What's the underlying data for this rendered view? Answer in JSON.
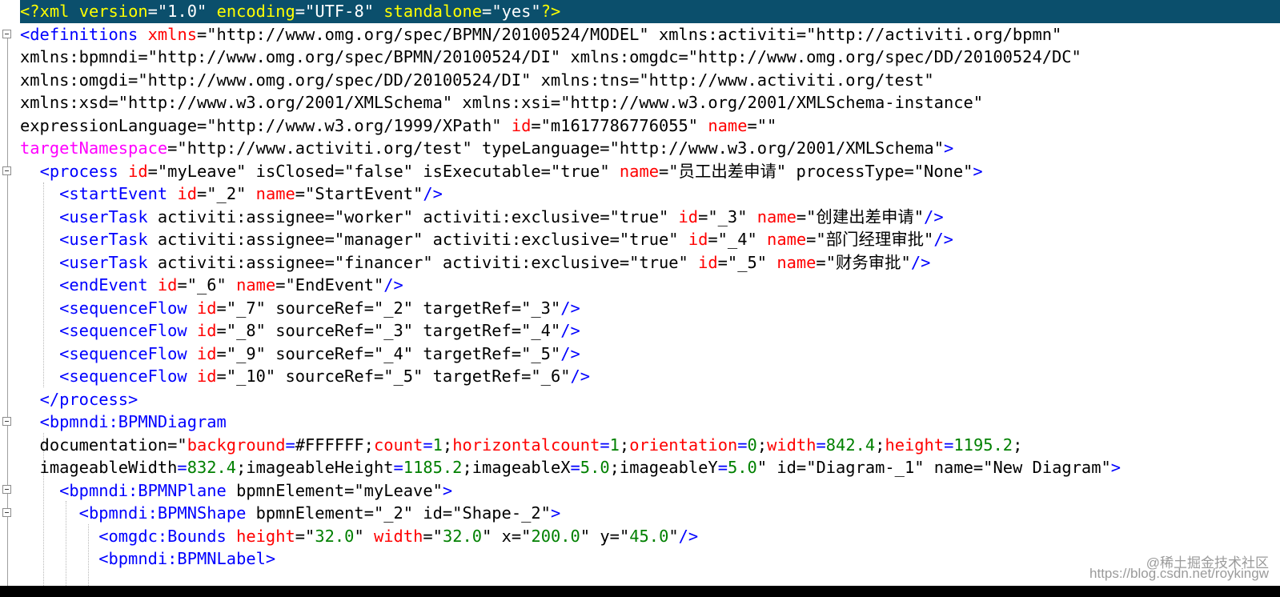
{
  "editor": {
    "lines": [
      {
        "kind": "decl",
        "segments": [
          {
            "c": "pi",
            "t": "<?"
          },
          {
            "c": "pi",
            "t": "xml"
          },
          {
            "c": "pv",
            "t": " "
          },
          {
            "c": "pi",
            "t": "version"
          },
          {
            "c": "pv",
            "t": "=\"1.0\" "
          },
          {
            "c": "pi",
            "t": "encoding"
          },
          {
            "c": "pv",
            "t": "=\"UTF-8\" "
          },
          {
            "c": "pi",
            "t": "standalone"
          },
          {
            "c": "pv",
            "t": "=\"yes\""
          },
          {
            "c": "pi",
            "t": "?>"
          }
        ]
      },
      {
        "segments": [
          {
            "c": "tg",
            "t": "<definitions"
          },
          {
            "c": "t",
            "t": " "
          },
          {
            "c": "at",
            "t": "xmlns"
          },
          {
            "c": "t",
            "t": "=\"http://www.omg.org/spec/BPMN/20100524/MODEL\" xmlns:activiti=\"http://activiti.org/bpmn\""
          }
        ]
      },
      {
        "segments": [
          {
            "c": "t",
            "t": "xmlns:bpmndi=\"http://www.omg.org/spec/BPMN/20100524/DI\" xmlns:omgdc=\"http://www.omg.org/spec/DD/20100524/DC\""
          }
        ]
      },
      {
        "segments": [
          {
            "c": "t",
            "t": "xmlns:omgdi=\"http://www.omg.org/spec/DD/20100524/DI\" xmlns:tns=\"http://www.activiti.org/test\""
          }
        ]
      },
      {
        "segments": [
          {
            "c": "t",
            "t": "xmlns:xsd=\"http://www.w3.org/2001/XMLSchema\" xmlns:xsi=\"http://www.w3.org/2001/XMLSchema-instance\""
          }
        ]
      },
      {
        "segments": [
          {
            "c": "t",
            "t": "expressionLanguage=\"http://www.w3.org/1999/XPath\" "
          },
          {
            "c": "at",
            "t": "id"
          },
          {
            "c": "t",
            "t": "=\"m1617786776055\" "
          },
          {
            "c": "at",
            "t": "name"
          },
          {
            "c": "t",
            "t": "=\"\""
          }
        ]
      },
      {
        "segments": [
          {
            "c": "kw",
            "t": "targetNamespace"
          },
          {
            "c": "t",
            "t": "=\"http://www.activiti.org/test\" typeLanguage=\"http://www.w3.org/2001/XMLSchema\""
          },
          {
            "c": "tg",
            "t": ">"
          }
        ]
      },
      {
        "segments": [
          {
            "c": "t",
            "t": "  "
          },
          {
            "c": "tg",
            "t": "<process"
          },
          {
            "c": "t",
            "t": " "
          },
          {
            "c": "at",
            "t": "id"
          },
          {
            "c": "t",
            "t": "=\"myLeave\" isClosed=\"false\" isExecutable=\"true\" "
          },
          {
            "c": "at",
            "t": "name"
          },
          {
            "c": "t",
            "t": "=\"员工出差申请\" processType=\"None\""
          },
          {
            "c": "tg",
            "t": ">"
          }
        ]
      },
      {
        "segments": [
          {
            "c": "t",
            "t": "    "
          },
          {
            "c": "tg",
            "t": "<startEvent"
          },
          {
            "c": "t",
            "t": " "
          },
          {
            "c": "at",
            "t": "id"
          },
          {
            "c": "t",
            "t": "=\"_2\" "
          },
          {
            "c": "at",
            "t": "name"
          },
          {
            "c": "t",
            "t": "=\"StartEvent\""
          },
          {
            "c": "tg",
            "t": "/>"
          }
        ]
      },
      {
        "segments": [
          {
            "c": "t",
            "t": "    "
          },
          {
            "c": "tg",
            "t": "<userTask"
          },
          {
            "c": "t",
            "t": " activiti:assignee=\"worker\" activiti:exclusive=\"true\" "
          },
          {
            "c": "at",
            "t": "id"
          },
          {
            "c": "t",
            "t": "=\"_3\" "
          },
          {
            "c": "at",
            "t": "name"
          },
          {
            "c": "t",
            "t": "=\"创建出差申请\""
          },
          {
            "c": "tg",
            "t": "/>"
          }
        ]
      },
      {
        "segments": [
          {
            "c": "t",
            "t": "    "
          },
          {
            "c": "tg",
            "t": "<userTask"
          },
          {
            "c": "t",
            "t": " activiti:assignee=\"manager\" activiti:exclusive=\"true\" "
          },
          {
            "c": "at",
            "t": "id"
          },
          {
            "c": "t",
            "t": "=\"_4\" "
          },
          {
            "c": "at",
            "t": "name"
          },
          {
            "c": "t",
            "t": "=\"部门经理审批\""
          },
          {
            "c": "tg",
            "t": "/>"
          }
        ]
      },
      {
        "segments": [
          {
            "c": "t",
            "t": "    "
          },
          {
            "c": "tg",
            "t": "<userTask"
          },
          {
            "c": "t",
            "t": " activiti:assignee=\"financer\" activiti:exclusive=\"true\" "
          },
          {
            "c": "at",
            "t": "id"
          },
          {
            "c": "t",
            "t": "=\"_5\" "
          },
          {
            "c": "at",
            "t": "name"
          },
          {
            "c": "t",
            "t": "=\"财务审批\""
          },
          {
            "c": "tg",
            "t": "/>"
          }
        ]
      },
      {
        "segments": [
          {
            "c": "t",
            "t": "    "
          },
          {
            "c": "tg",
            "t": "<endEvent"
          },
          {
            "c": "t",
            "t": " "
          },
          {
            "c": "at",
            "t": "id"
          },
          {
            "c": "t",
            "t": "=\"_6\" "
          },
          {
            "c": "at",
            "t": "name"
          },
          {
            "c": "t",
            "t": "=\"EndEvent\""
          },
          {
            "c": "tg",
            "t": "/>"
          }
        ]
      },
      {
        "segments": [
          {
            "c": "t",
            "t": "    "
          },
          {
            "c": "tg",
            "t": "<sequenceFlow"
          },
          {
            "c": "t",
            "t": " "
          },
          {
            "c": "at",
            "t": "id"
          },
          {
            "c": "t",
            "t": "=\"_7\" sourceRef=\"_2\" targetRef=\"_3\""
          },
          {
            "c": "tg",
            "t": "/>"
          }
        ]
      },
      {
        "segments": [
          {
            "c": "t",
            "t": "    "
          },
          {
            "c": "tg",
            "t": "<sequenceFlow"
          },
          {
            "c": "t",
            "t": " "
          },
          {
            "c": "at",
            "t": "id"
          },
          {
            "c": "t",
            "t": "=\"_8\" sourceRef=\"_3\" targetRef=\"_4\""
          },
          {
            "c": "tg",
            "t": "/>"
          }
        ]
      },
      {
        "segments": [
          {
            "c": "t",
            "t": "    "
          },
          {
            "c": "tg",
            "t": "<sequenceFlow"
          },
          {
            "c": "t",
            "t": " "
          },
          {
            "c": "at",
            "t": "id"
          },
          {
            "c": "t",
            "t": "=\"_9\" sourceRef=\"_4\" targetRef=\"_5\""
          },
          {
            "c": "tg",
            "t": "/>"
          }
        ]
      },
      {
        "segments": [
          {
            "c": "t",
            "t": "    "
          },
          {
            "c": "tg",
            "t": "<sequenceFlow"
          },
          {
            "c": "t",
            "t": " "
          },
          {
            "c": "at",
            "t": "id"
          },
          {
            "c": "t",
            "t": "=\"_10\" sourceRef=\"_5\" targetRef=\"_6\""
          },
          {
            "c": "tg",
            "t": "/>"
          }
        ]
      },
      {
        "segments": [
          {
            "c": "t",
            "t": "  "
          },
          {
            "c": "tg",
            "t": "</process>"
          }
        ]
      },
      {
        "segments": [
          {
            "c": "t",
            "t": "  "
          },
          {
            "c": "tg",
            "t": "<bpmndi:BPMNDiagram"
          }
        ]
      },
      {
        "segments": [
          {
            "c": "t",
            "t": "  documentation=\""
          },
          {
            "c": "at",
            "t": "background"
          },
          {
            "c": "op",
            "t": "="
          },
          {
            "c": "t",
            "t": "#FFFFFF;"
          },
          {
            "c": "at",
            "t": "count"
          },
          {
            "c": "op",
            "t": "="
          },
          {
            "c": "nm",
            "t": "1"
          },
          {
            "c": "t",
            "t": ";"
          },
          {
            "c": "at",
            "t": "horizontalcount"
          },
          {
            "c": "op",
            "t": "="
          },
          {
            "c": "nm",
            "t": "1"
          },
          {
            "c": "t",
            "t": ";"
          },
          {
            "c": "at",
            "t": "orientation"
          },
          {
            "c": "op",
            "t": "="
          },
          {
            "c": "nm",
            "t": "0"
          },
          {
            "c": "t",
            "t": ";"
          },
          {
            "c": "at",
            "t": "width"
          },
          {
            "c": "op",
            "t": "="
          },
          {
            "c": "nm",
            "t": "842.4"
          },
          {
            "c": "t",
            "t": ";"
          },
          {
            "c": "at",
            "t": "height"
          },
          {
            "c": "op",
            "t": "="
          },
          {
            "c": "nm",
            "t": "1195.2"
          },
          {
            "c": "t",
            "t": ";"
          }
        ]
      },
      {
        "segments": [
          {
            "c": "t",
            "t": "  imageableWidth"
          },
          {
            "c": "op",
            "t": "="
          },
          {
            "c": "nm",
            "t": "832.4"
          },
          {
            "c": "t",
            "t": ";imageableHeight"
          },
          {
            "c": "op",
            "t": "="
          },
          {
            "c": "nm",
            "t": "1185.2"
          },
          {
            "c": "t",
            "t": ";imageableX"
          },
          {
            "c": "op",
            "t": "="
          },
          {
            "c": "nm",
            "t": "5.0"
          },
          {
            "c": "t",
            "t": ";imageableY"
          },
          {
            "c": "op",
            "t": "="
          },
          {
            "c": "nm",
            "t": "5.0"
          },
          {
            "c": "t",
            "t": "\" id=\"Diagram-_1\" name=\"New Diagram\""
          },
          {
            "c": "tg",
            "t": ">"
          }
        ]
      },
      {
        "segments": [
          {
            "c": "t",
            "t": "    "
          },
          {
            "c": "tg",
            "t": "<bpmndi:BPMNPlane"
          },
          {
            "c": "t",
            "t": " bpmnElement=\"myLeave\""
          },
          {
            "c": "tg",
            "t": ">"
          }
        ]
      },
      {
        "segments": [
          {
            "c": "t",
            "t": "      "
          },
          {
            "c": "tg",
            "t": "<bpmndi:BPMNShape"
          },
          {
            "c": "t",
            "t": " bpmnElement=\"_2\" id=\"Shape-_2\""
          },
          {
            "c": "tg",
            "t": ">"
          }
        ]
      },
      {
        "segments": [
          {
            "c": "t",
            "t": "        "
          },
          {
            "c": "tg",
            "t": "<omgdc:Bounds"
          },
          {
            "c": "t",
            "t": " "
          },
          {
            "c": "at",
            "t": "height"
          },
          {
            "c": "t",
            "t": "=\""
          },
          {
            "c": "nm",
            "t": "32.0"
          },
          {
            "c": "t",
            "t": "\" "
          },
          {
            "c": "at",
            "t": "width"
          },
          {
            "c": "t",
            "t": "=\""
          },
          {
            "c": "nm",
            "t": "32.0"
          },
          {
            "c": "t",
            "t": "\" x=\""
          },
          {
            "c": "nm",
            "t": "200.0"
          },
          {
            "c": "t",
            "t": "\" y=\""
          },
          {
            "c": "nm",
            "t": "45.0"
          },
          {
            "c": "t",
            "t": "\""
          },
          {
            "c": "tg",
            "t": "/>"
          }
        ]
      },
      {
        "segments": [
          {
            "c": "t",
            "t": "        "
          },
          {
            "c": "tg",
            "t": "<bpmndi:BPMNLabel>"
          }
        ]
      }
    ]
  },
  "watermark": {
    "brand": "@稀土掘金技术社区",
    "url": "https://blog.csdn.net/roykingw"
  },
  "colors": {
    "tag": "#0000ff",
    "attribute": "#ff0000",
    "value": "#000000",
    "number": "#008000",
    "namespace_attr": "#ff00ff",
    "decl_background": "#0b4f6c",
    "decl_text": "#ffff00",
    "editor_background": "#ffffff"
  },
  "gutter": {
    "icons": [
      "fold-minus-icon"
    ]
  }
}
